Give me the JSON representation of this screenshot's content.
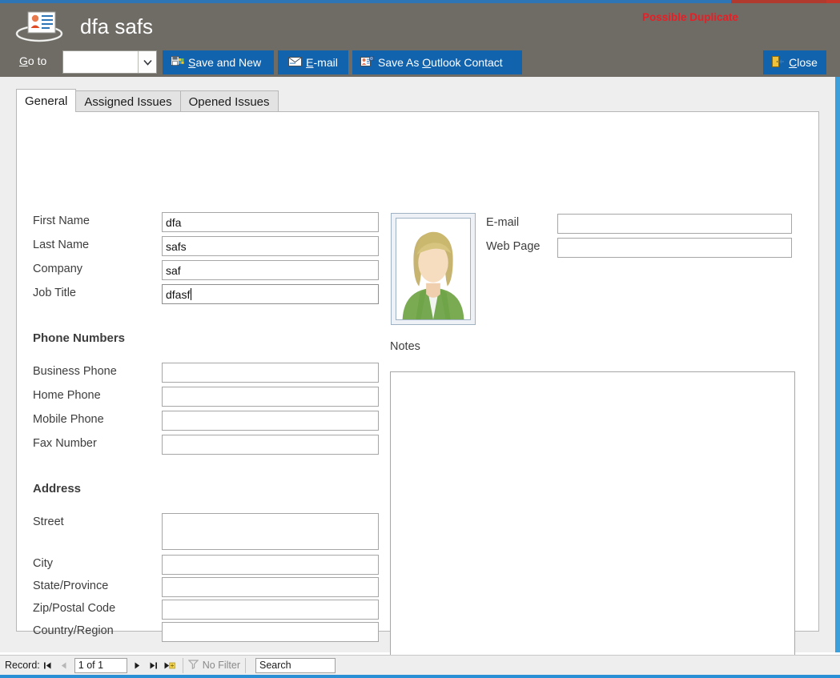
{
  "window": {
    "accent_blue": "#2e75b6",
    "header_bg": "#6f6c66",
    "button_blue": "#1263ae",
    "duplicate_color": "#ec1c24"
  },
  "header": {
    "title": "dfa safs",
    "icon": "contact-card-icon",
    "duplicate_warning": "Possible Duplicate",
    "goto_label_pre": "G",
    "goto_label_rest": "o to",
    "goto_value": "",
    "buttons": [
      {
        "id": "save-and-new",
        "pre": "",
        "accel": "S",
        "rest": "ave and New",
        "icon": "save-new-icon"
      },
      {
        "id": "email",
        "pre": "",
        "accel": "E",
        "rest": "-mail",
        "icon": "email-icon"
      },
      {
        "id": "save-as-outlook-contact",
        "pre": "Save As ",
        "accel": "O",
        "rest": "utlook Contact",
        "icon": "outlook-contact-icon"
      },
      {
        "id": "close",
        "pre": "",
        "accel": "C",
        "rest": "lose",
        "icon": "close-door-icon"
      }
    ]
  },
  "tabs": [
    {
      "label": "General",
      "active": true
    },
    {
      "label": "Assigned Issues",
      "active": false
    },
    {
      "label": "Opened Issues",
      "active": false
    }
  ],
  "form": {
    "identity": {
      "fields": [
        {
          "label": "First Name",
          "value": "dfa",
          "focused": false
        },
        {
          "label": "Last Name",
          "value": "safs",
          "focused": false
        },
        {
          "label": "Company",
          "value": "saf",
          "focused": false
        },
        {
          "label": "Job Title",
          "value": "dfasf",
          "focused": true
        }
      ]
    },
    "phone": {
      "heading": "Phone Numbers",
      "fields": [
        {
          "label": "Business Phone",
          "value": ""
        },
        {
          "label": "Home Phone",
          "value": ""
        },
        {
          "label": "Mobile Phone",
          "value": ""
        },
        {
          "label": "Fax Number",
          "value": ""
        }
      ]
    },
    "address": {
      "heading": "Address",
      "fields": [
        {
          "label": "Street",
          "value": ""
        },
        {
          "label": "City",
          "value": ""
        },
        {
          "label": "State/Province",
          "value": ""
        },
        {
          "label": "Zip/Postal Code",
          "value": ""
        },
        {
          "label": "Country/Region",
          "value": ""
        }
      ]
    },
    "contact": {
      "fields": [
        {
          "label": "E-mail",
          "value": ""
        },
        {
          "label": "Web Page",
          "value": ""
        }
      ]
    },
    "avatar": {
      "icon": "person-photo-placeholder"
    },
    "notes": {
      "label": "Notes",
      "value": ""
    }
  },
  "status": {
    "record_label": "Record:",
    "record_position": "1 of 1",
    "first_icon": "first-record-icon",
    "prev_icon": "previous-record-icon",
    "next_icon": "next-record-icon",
    "last_icon": "last-record-icon",
    "new_icon": "new-record-icon",
    "filter_icon": "filter-icon",
    "filter_text": "No Filter",
    "search_text": "Search"
  }
}
